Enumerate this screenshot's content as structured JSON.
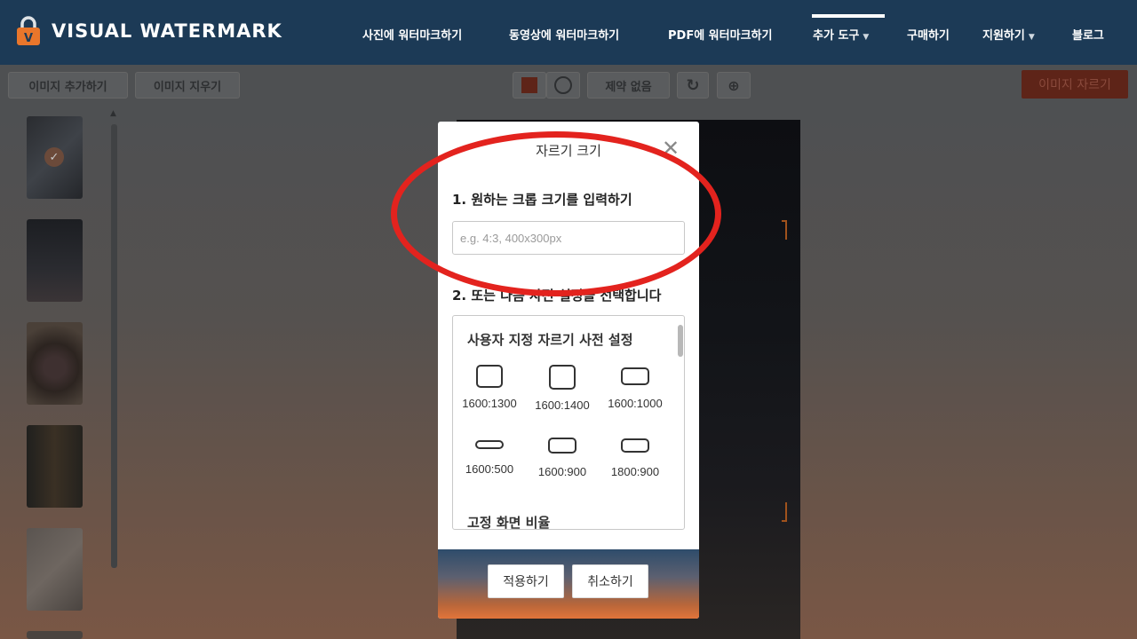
{
  "header": {
    "brand": "VISUAL WATERMARK",
    "nav": [
      {
        "label": "사진에 워터마크하기"
      },
      {
        "label": "동영상에 워터마크하기"
      },
      {
        "label": "PDF에 워터마크하기"
      },
      {
        "label": "추가 도구"
      },
      {
        "label": "구매하기"
      },
      {
        "label": "지원하기"
      },
      {
        "label": "블로그"
      }
    ],
    "active_nav": "추가 도구"
  },
  "toolbar": {
    "add_images": "이미지 추가하기",
    "remove_images": "이미지 지우기",
    "no_constraint": "제약 없음",
    "crop_images": "이미지 자르기"
  },
  "modal": {
    "title": "자르기 크기",
    "step1_label": "1. 원하는 크롭 크기를 입력하기",
    "size_input": {
      "value": "",
      "placeholder": "e.g. 4:3, 400x300px"
    },
    "step2_label": "2. 또는 다음 사전 설정을 선택합니다",
    "presets_heading": "사용자 지정 자르기 사전 설정",
    "presets": [
      {
        "label": "1600:1300"
      },
      {
        "label": "1600:1400"
      },
      {
        "label": "1600:1000"
      },
      {
        "label": "1600:500"
      },
      {
        "label": "1600:900"
      },
      {
        "label": "1800:900"
      }
    ],
    "fixed_ratio_heading": "고정 화면 비율",
    "apply": "적용하기",
    "cancel": "취소하기"
  },
  "colors": {
    "header_bg": "#1c3a56",
    "crop_button": "#5e2418",
    "annotation": "#e3231e",
    "brand_accent": "#e9762b"
  }
}
